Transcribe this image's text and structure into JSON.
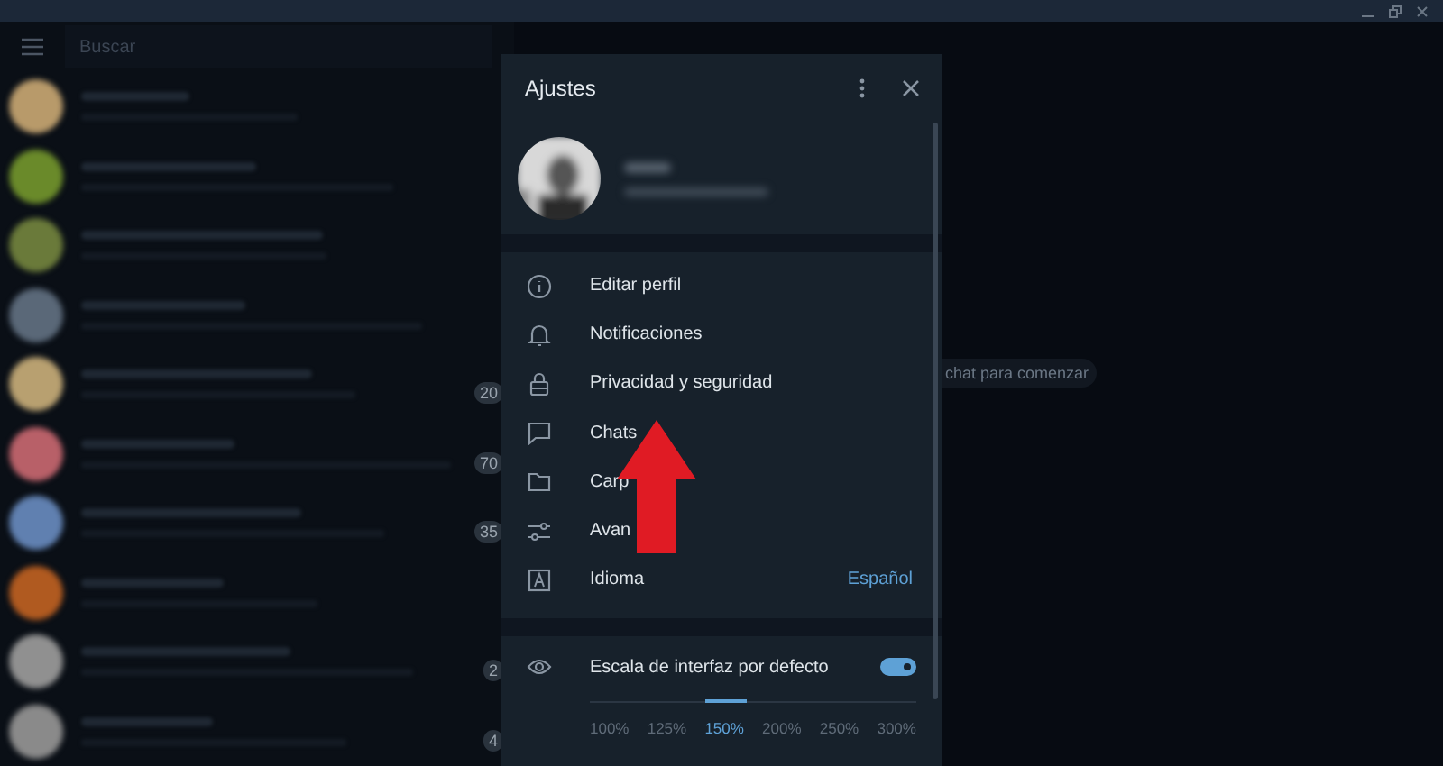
{
  "search": {
    "placeholder": "Buscar"
  },
  "chats": [
    {
      "color": "#b89a6a"
    },
    {
      "color": "#6a8a2a"
    },
    {
      "color": "#6a7a3a"
    },
    {
      "color": "#5a6878"
    },
    {
      "color": "#b8a070",
      "badge": "20"
    },
    {
      "color": "#b86068",
      "badge": "70"
    },
    {
      "color": "#6080b0",
      "badge": "35"
    },
    {
      "color": "#b05a20"
    },
    {
      "color": "#909090",
      "badge": "2"
    },
    {
      "color": "#8a8a8a",
      "badge": "4"
    }
  ],
  "empty_hint": "chat para comenzar",
  "settings": {
    "title": "Ajustes",
    "menu": [
      {
        "label": "Editar perfil"
      },
      {
        "label": "Notificaciones"
      },
      {
        "label": "Privacidad y seguridad"
      },
      {
        "label": "Chats"
      },
      {
        "label": "Carp"
      },
      {
        "label": "Avan"
      },
      {
        "label": "Idioma",
        "value": "Español"
      }
    ],
    "scale": {
      "label": "Escala de interfaz por defecto",
      "on": true,
      "options": [
        {
          "label": "100%",
          "selected": false
        },
        {
          "label": "125%",
          "selected": false
        },
        {
          "label": "150%",
          "selected": true
        },
        {
          "label": "200%",
          "selected": false
        },
        {
          "label": "250%",
          "selected": false
        },
        {
          "label": "300%",
          "selected": false
        }
      ]
    }
  }
}
